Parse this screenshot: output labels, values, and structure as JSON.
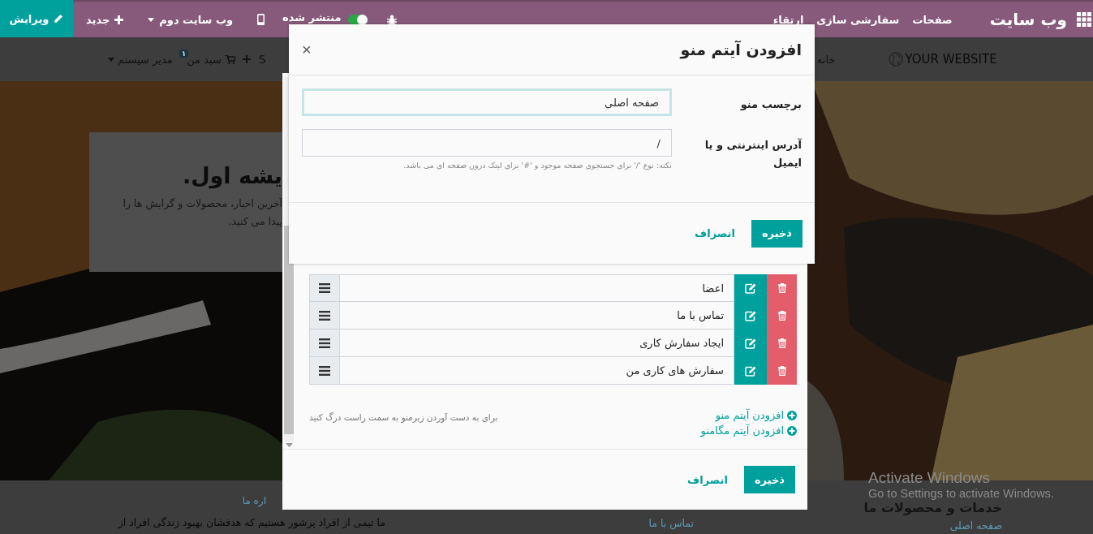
{
  "top_bar": {
    "brand": "وب سایت",
    "menu": [
      {
        "label": "صفحات"
      },
      {
        "label": "سفارشی سازی"
      },
      {
        "label": "ارتقاء"
      }
    ],
    "published": {
      "label": "منتشر شده",
      "on": true
    },
    "website_switcher": "وب سایت دوم",
    "new_button": "جدید",
    "edit_button": "ویرایش"
  },
  "site_nav": {
    "logo": "YOUR WEBSITE",
    "home": "خانه",
    "cut_item": "S",
    "cart": {
      "label": "سبد من",
      "count": "۱"
    },
    "user": "مدیر سیستم"
  },
  "hero": {
    "kind": "picture",
    "heading": "یشه اول.",
    "text_lines": [
      "آخرین اخبار، محصولات و گرایش ها را",
      "پیدا می کنید."
    ]
  },
  "footer": {
    "about_heading": "اره ما",
    "about_text": "ما تیمی از افراد پرشور هستیم که هدفشان بهبود زندگی افراد از",
    "contact_link": "تماس با ما",
    "services_heading": "خدمات و محصولات ما",
    "home_link": "صفحه اصلی"
  },
  "menu_editor": {
    "items": [
      {
        "label": "اعضا"
      },
      {
        "label": "تماس با ما"
      },
      {
        "label": "ایجاد سفارش کاری"
      },
      {
        "label": "سفارش های کاری من"
      }
    ],
    "hint": "برای به دست آوردن زیرمنو به سمت راست درگ کنید",
    "add_links": [
      "افزودن آیتم منو",
      "افزودن آیتم مگامنو"
    ],
    "save": "ذخیره",
    "cancel": "انصراف"
  },
  "add_item_dialog": {
    "title": "افزودن آیتم منو",
    "close": "×",
    "fields": [
      {
        "label": "برچسب منو",
        "value": "صفحه اصلی",
        "focused": true
      },
      {
        "label": "آدرس اینترنتی و یا ایمیل",
        "value": "/",
        "focused": false,
        "help": "نکته: نوع '/' برای جستجوی صفحه موجود و '#' برای لینک درون صفحه ای می باشد."
      }
    ],
    "save": "ذخیره",
    "cancel": "انصراف"
  },
  "os_notice": {
    "title": "Activate Windows",
    "text": "Go to Settings to activate Windows."
  }
}
